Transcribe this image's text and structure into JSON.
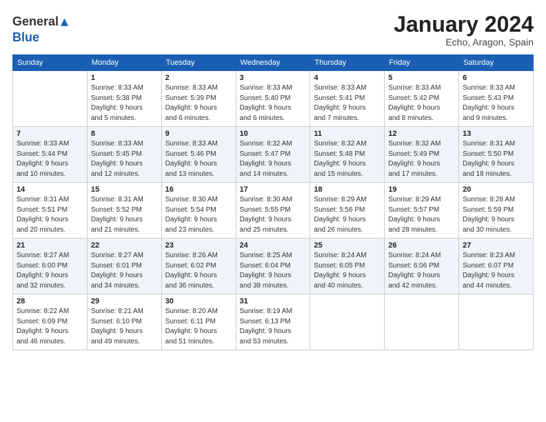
{
  "logo": {
    "general": "General",
    "blue": "Blue"
  },
  "title": "January 2024",
  "subtitle": "Echo, Aragon, Spain",
  "days_of_week": [
    "Sunday",
    "Monday",
    "Tuesday",
    "Wednesday",
    "Thursday",
    "Friday",
    "Saturday"
  ],
  "weeks": [
    [
      {
        "day": "",
        "info": ""
      },
      {
        "day": "1",
        "info": "Sunrise: 8:33 AM\nSunset: 5:38 PM\nDaylight: 9 hours\nand 5 minutes."
      },
      {
        "day": "2",
        "info": "Sunrise: 8:33 AM\nSunset: 5:39 PM\nDaylight: 9 hours\nand 6 minutes."
      },
      {
        "day": "3",
        "info": "Sunrise: 8:33 AM\nSunset: 5:40 PM\nDaylight: 9 hours\nand 6 minutes."
      },
      {
        "day": "4",
        "info": "Sunrise: 8:33 AM\nSunset: 5:41 PM\nDaylight: 9 hours\nand 7 minutes."
      },
      {
        "day": "5",
        "info": "Sunrise: 8:33 AM\nSunset: 5:42 PM\nDaylight: 9 hours\nand 8 minutes."
      },
      {
        "day": "6",
        "info": "Sunrise: 8:33 AM\nSunset: 5:43 PM\nDaylight: 9 hours\nand 9 minutes."
      }
    ],
    [
      {
        "day": "7",
        "info": "Sunrise: 8:33 AM\nSunset: 5:44 PM\nDaylight: 9 hours\nand 10 minutes."
      },
      {
        "day": "8",
        "info": "Sunrise: 8:33 AM\nSunset: 5:45 PM\nDaylight: 9 hours\nand 12 minutes."
      },
      {
        "day": "9",
        "info": "Sunrise: 8:33 AM\nSunset: 5:46 PM\nDaylight: 9 hours\nand 13 minutes."
      },
      {
        "day": "10",
        "info": "Sunrise: 8:32 AM\nSunset: 5:47 PM\nDaylight: 9 hours\nand 14 minutes."
      },
      {
        "day": "11",
        "info": "Sunrise: 8:32 AM\nSunset: 5:48 PM\nDaylight: 9 hours\nand 15 minutes."
      },
      {
        "day": "12",
        "info": "Sunrise: 8:32 AM\nSunset: 5:49 PM\nDaylight: 9 hours\nand 17 minutes."
      },
      {
        "day": "13",
        "info": "Sunrise: 8:31 AM\nSunset: 5:50 PM\nDaylight: 9 hours\nand 18 minutes."
      }
    ],
    [
      {
        "day": "14",
        "info": "Sunrise: 8:31 AM\nSunset: 5:51 PM\nDaylight: 9 hours\nand 20 minutes."
      },
      {
        "day": "15",
        "info": "Sunrise: 8:31 AM\nSunset: 5:52 PM\nDaylight: 9 hours\nand 21 minutes."
      },
      {
        "day": "16",
        "info": "Sunrise: 8:30 AM\nSunset: 5:54 PM\nDaylight: 9 hours\nand 23 minutes."
      },
      {
        "day": "17",
        "info": "Sunrise: 8:30 AM\nSunset: 5:55 PM\nDaylight: 9 hours\nand 25 minutes."
      },
      {
        "day": "18",
        "info": "Sunrise: 8:29 AM\nSunset: 5:56 PM\nDaylight: 9 hours\nand 26 minutes."
      },
      {
        "day": "19",
        "info": "Sunrise: 8:29 AM\nSunset: 5:57 PM\nDaylight: 9 hours\nand 28 minutes."
      },
      {
        "day": "20",
        "info": "Sunrise: 8:28 AM\nSunset: 5:59 PM\nDaylight: 9 hours\nand 30 minutes."
      }
    ],
    [
      {
        "day": "21",
        "info": "Sunrise: 8:27 AM\nSunset: 6:00 PM\nDaylight: 9 hours\nand 32 minutes."
      },
      {
        "day": "22",
        "info": "Sunrise: 8:27 AM\nSunset: 6:01 PM\nDaylight: 9 hours\nand 34 minutes."
      },
      {
        "day": "23",
        "info": "Sunrise: 8:26 AM\nSunset: 6:02 PM\nDaylight: 9 hours\nand 36 minutes."
      },
      {
        "day": "24",
        "info": "Sunrise: 8:25 AM\nSunset: 6:04 PM\nDaylight: 9 hours\nand 38 minutes."
      },
      {
        "day": "25",
        "info": "Sunrise: 8:24 AM\nSunset: 6:05 PM\nDaylight: 9 hours\nand 40 minutes."
      },
      {
        "day": "26",
        "info": "Sunrise: 8:24 AM\nSunset: 6:06 PM\nDaylight: 9 hours\nand 42 minutes."
      },
      {
        "day": "27",
        "info": "Sunrise: 8:23 AM\nSunset: 6:07 PM\nDaylight: 9 hours\nand 44 minutes."
      }
    ],
    [
      {
        "day": "28",
        "info": "Sunrise: 8:22 AM\nSunset: 6:09 PM\nDaylight: 9 hours\nand 46 minutes."
      },
      {
        "day": "29",
        "info": "Sunrise: 8:21 AM\nSunset: 6:10 PM\nDaylight: 9 hours\nand 49 minutes."
      },
      {
        "day": "30",
        "info": "Sunrise: 8:20 AM\nSunset: 6:11 PM\nDaylight: 9 hours\nand 51 minutes."
      },
      {
        "day": "31",
        "info": "Sunrise: 8:19 AM\nSunset: 6:13 PM\nDaylight: 9 hours\nand 53 minutes."
      },
      {
        "day": "",
        "info": ""
      },
      {
        "day": "",
        "info": ""
      },
      {
        "day": "",
        "info": ""
      }
    ]
  ]
}
